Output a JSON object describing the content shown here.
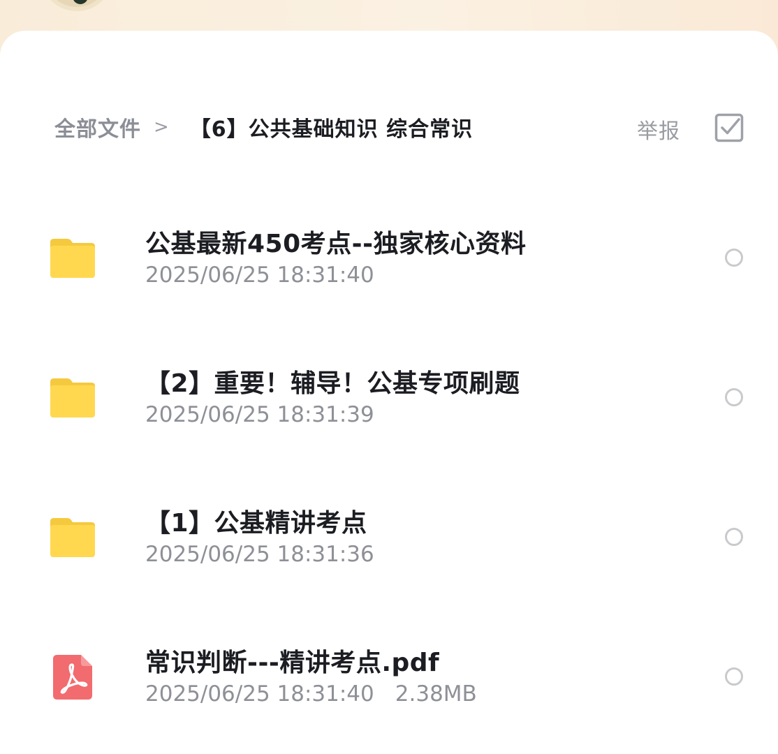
{
  "breadcrumb": {
    "root": "全部文件",
    "separator": ">",
    "current": "【6】公共基础知识 综合常识"
  },
  "header": {
    "report_label": "举报"
  },
  "colors": {
    "folder": "#ffd74f",
    "pdf": "#f26b6f",
    "title_text": "#1c1d22",
    "meta_text": "#8e9097"
  },
  "files": [
    {
      "type": "folder",
      "icon": "folder-icon",
      "name": "公基最新450考点--独家核心资料",
      "time": "2025/06/25 18:31:40",
      "size": ""
    },
    {
      "type": "folder",
      "icon": "folder-icon",
      "name": "【2】重要！辅导！公基专项刷题",
      "time": "2025/06/25 18:31:39",
      "size": ""
    },
    {
      "type": "folder",
      "icon": "folder-icon",
      "name": "【1】公基精讲考点",
      "time": "2025/06/25 18:31:36",
      "size": ""
    },
    {
      "type": "pdf",
      "icon": "pdf-icon",
      "name": "常识判断---精讲考点.pdf",
      "time": "2025/06/25 18:31:40",
      "size": "2.38MB"
    }
  ]
}
